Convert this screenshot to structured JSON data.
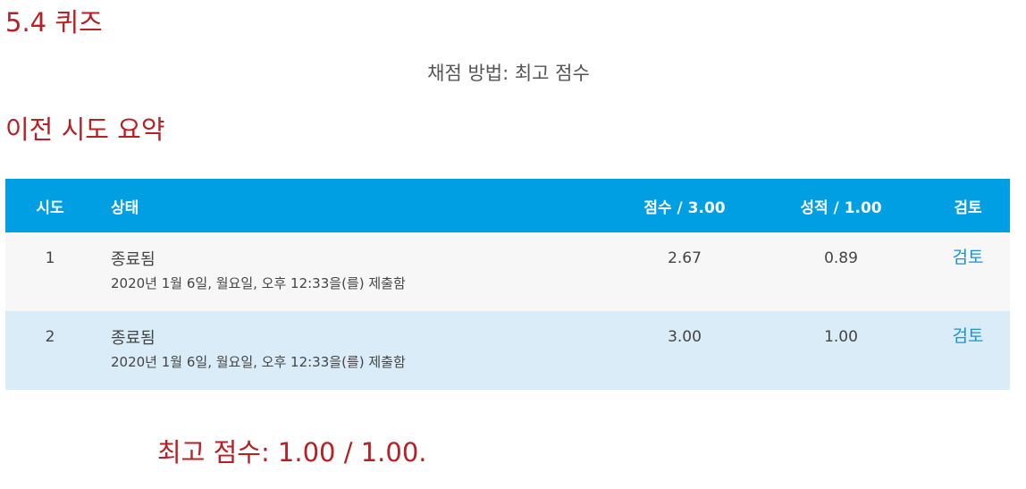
{
  "page": {
    "title": "5.4 퀴즈",
    "grading_method": "채점 방법: 최고 점수",
    "summary_heading": "이전 시도 요약",
    "final_score": "최고 점수: 1.00 / 1.00."
  },
  "table": {
    "headers": {
      "attempt": "시도",
      "state": "상태",
      "marks": "점수 / 3.00",
      "grade": "성적 / 1.00",
      "review": "검토"
    },
    "rows": [
      {
        "attempt": "1",
        "state": "종료됨",
        "submitted": "2020년 1월 6일, 월요일, 오후 12:33을(를) 제출함",
        "marks": "2.67",
        "grade": "0.89",
        "review": "검토"
      },
      {
        "attempt": "2",
        "state": "종료됨",
        "submitted": "2020년 1월 6일, 월요일, 오후 12:33을(를) 제출함",
        "marks": "3.00",
        "grade": "1.00",
        "review": "검토"
      }
    ]
  },
  "colors": {
    "heading_red": "#b72025",
    "header_blue": "#009fe3",
    "row_odd": "#f7f7f7",
    "row_even": "#d9ecf7",
    "link_blue": "#1b92d1"
  }
}
